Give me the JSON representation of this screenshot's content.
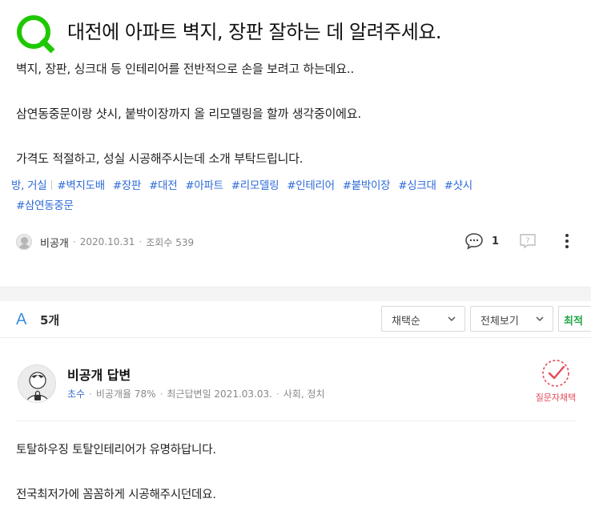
{
  "question": {
    "title": "대전에 아파트 벽지, 장판 잘하는 데 알려주세요.",
    "body": [
      "벽지, 장판, 싱크대 등 인테리어를 전반적으로 손을 보려고 하는데요..",
      "삼연동중문이랑 샷시, 붙박이장까지 올 리모델링을 할까 생각중이에요.",
      "가격도 적절하고, 성실 시공해주시는데 소개 부탁드립니다."
    ],
    "category": "방, 거실",
    "tags": [
      "#벽지도배",
      "#장판",
      "#대전",
      "#아파트",
      "#리모델링",
      "#인테리어",
      "#붙박이장",
      "#싱크대",
      "#샷시",
      "#삼연동중문"
    ],
    "author": "비공개",
    "date": "2020.10.31",
    "views_label": "조회수 539",
    "comment_count": "1"
  },
  "answers_header": {
    "mark": "A",
    "count_label": "5개",
    "sort_select": "채택순",
    "view_select": "전체보기",
    "latest_label": "최적"
  },
  "answer": {
    "answerer": "비공개 답변",
    "grade": "초수",
    "private_rate": "비공개율 78%",
    "last_answer": "최근답변일 2021.03.03.",
    "field": "사회, 정치",
    "adopt_label": "질문자채택",
    "body": [
      "토탈하우징 토탈인테리어가 유명하답니다.",
      "전국최저가에 꼼꼼하게 시공해주시던데요."
    ]
  },
  "colors": {
    "q_mark": "#1ec800",
    "link": "#2d6ad8",
    "a_mark": "#3b8ee3",
    "adopt": "#e34b57",
    "latest": "#20a545"
  }
}
